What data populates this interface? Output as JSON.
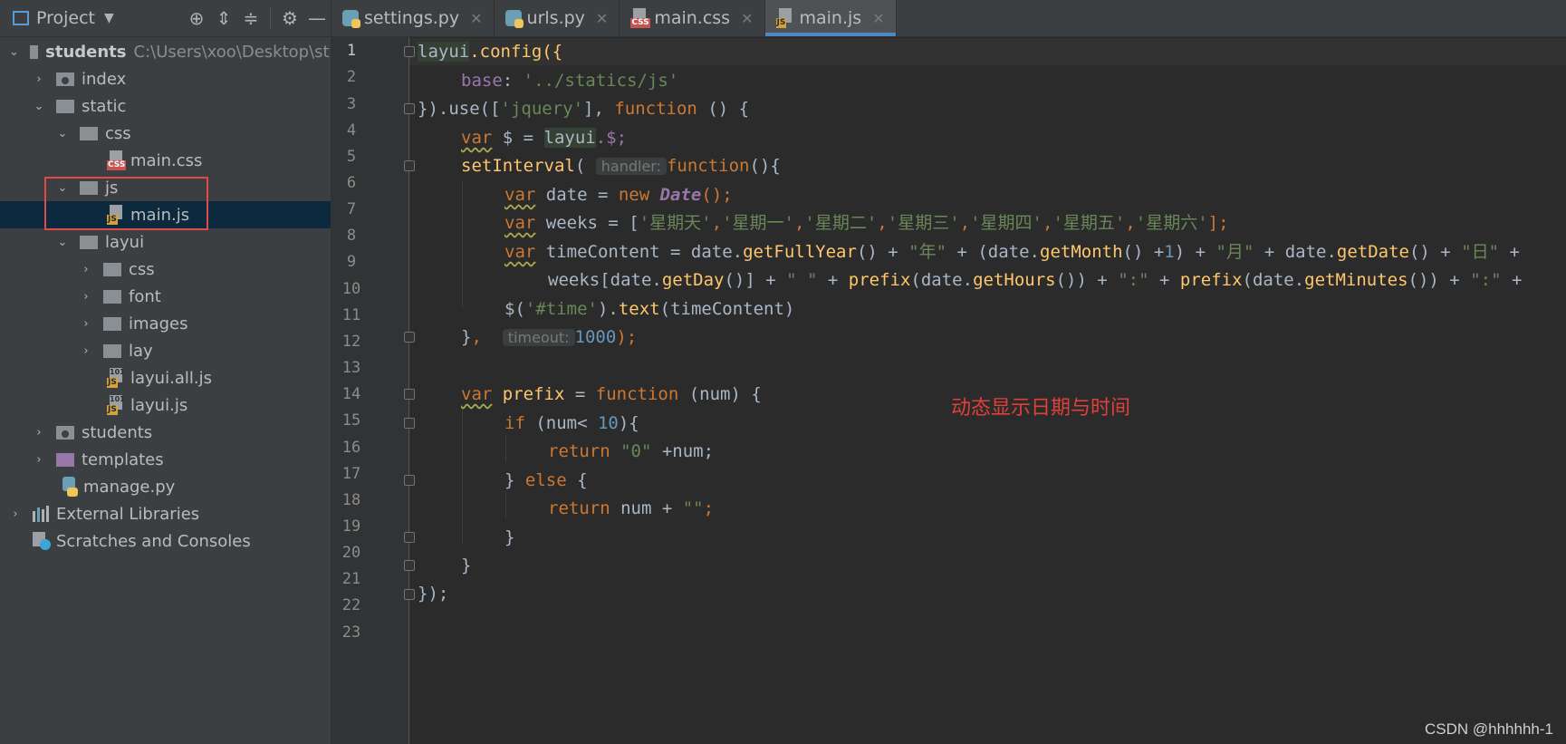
{
  "project_panel": {
    "title": "Project",
    "root_name": "students",
    "root_path": "C:\\Users\\xoo\\Desktop\\stu",
    "items": [
      {
        "label": "index"
      },
      {
        "label": "static"
      },
      {
        "label": "css"
      },
      {
        "label": "main.css"
      },
      {
        "label": "js"
      },
      {
        "label": "main.js"
      },
      {
        "label": "layui"
      },
      {
        "label": "css"
      },
      {
        "label": "font"
      },
      {
        "label": "images"
      },
      {
        "label": "lay"
      },
      {
        "label": "layui.all.js"
      },
      {
        "label": "layui.js"
      },
      {
        "label": "students"
      },
      {
        "label": "templates"
      },
      {
        "label": "manage.py"
      },
      {
        "label": "External Libraries"
      },
      {
        "label": "Scratches and Consoles"
      }
    ]
  },
  "tabs": [
    {
      "label": "settings.py"
    },
    {
      "label": "urls.py"
    },
    {
      "label": "main.css"
    },
    {
      "label": "main.js",
      "active": true
    }
  ],
  "editor": {
    "line_numbers": [
      "1",
      "2",
      "3",
      "4",
      "5",
      "6",
      "7",
      "8",
      "9",
      "10",
      "11",
      "12",
      "13",
      "14",
      "15",
      "16",
      "17",
      "18",
      "19",
      "20",
      "21",
      "22",
      "23"
    ],
    "tokens": {
      "l1": [
        "layui",
        ".config({"
      ],
      "l2": [
        "base",
        ": ",
        "'../statics/js'"
      ],
      "l3": [
        "}).use([",
        "'jquery'",
        "], ",
        "function",
        " () {"
      ],
      "l4": [
        "var",
        " $ = ",
        "layui",
        ".$;"
      ],
      "l5": [
        "setInterval",
        "(",
        "handler:",
        "function",
        "(){"
      ],
      "l6": [
        "var",
        " date = ",
        "new ",
        "Date",
        "();"
      ],
      "l7": [
        "var",
        " weeks = [",
        "'星期天'",
        ",",
        "'星期一'",
        ",",
        "'星期二'",
        ",",
        "'星期三'",
        ",",
        "'星期四'",
        ",",
        "'星期五'",
        ",",
        "'星期六'",
        "];"
      ],
      "l8": [
        "var",
        " timeContent = date.",
        "getFullYear",
        "() + ",
        "\"年\"",
        " + (date.",
        "getMonth",
        "() +",
        "1",
        ") + ",
        "\"月\"",
        " + date.",
        "getDate",
        "() + ",
        "\"日\"",
        " +"
      ],
      "l9": [
        "weeks[date.",
        "getDay",
        "()] + ",
        "\" \"",
        " + ",
        "prefix",
        "(date.",
        "getHours",
        "()) + ",
        "\":\"",
        " + ",
        "prefix",
        "(date.",
        "getMinutes",
        "()) + ",
        "\":\"",
        " +"
      ],
      "l10": [
        "$(",
        "'#time'",
        ").",
        "text",
        "(timeContent)"
      ],
      "l11": [
        "}",
        ", ",
        "timeout:",
        "1000",
        ");"
      ],
      "l13": [
        "var",
        " ",
        "prefix",
        " = ",
        "function",
        " (num) {"
      ],
      "l14": [
        "if",
        " (num< ",
        "10",
        "){"
      ],
      "l15": [
        "return",
        " ",
        "\"0\"",
        " +num;"
      ],
      "l16": [
        "} ",
        "else",
        " {"
      ],
      "l17": [
        "return",
        " num + ",
        "\"\"",
        ";"
      ],
      "l18": [
        "}"
      ],
      "l19": [
        "}"
      ],
      "l20": [
        "});"
      ]
    }
  },
  "annotation": "动态显示日期与时间",
  "watermark": "CSDN @hhhhhh-1"
}
